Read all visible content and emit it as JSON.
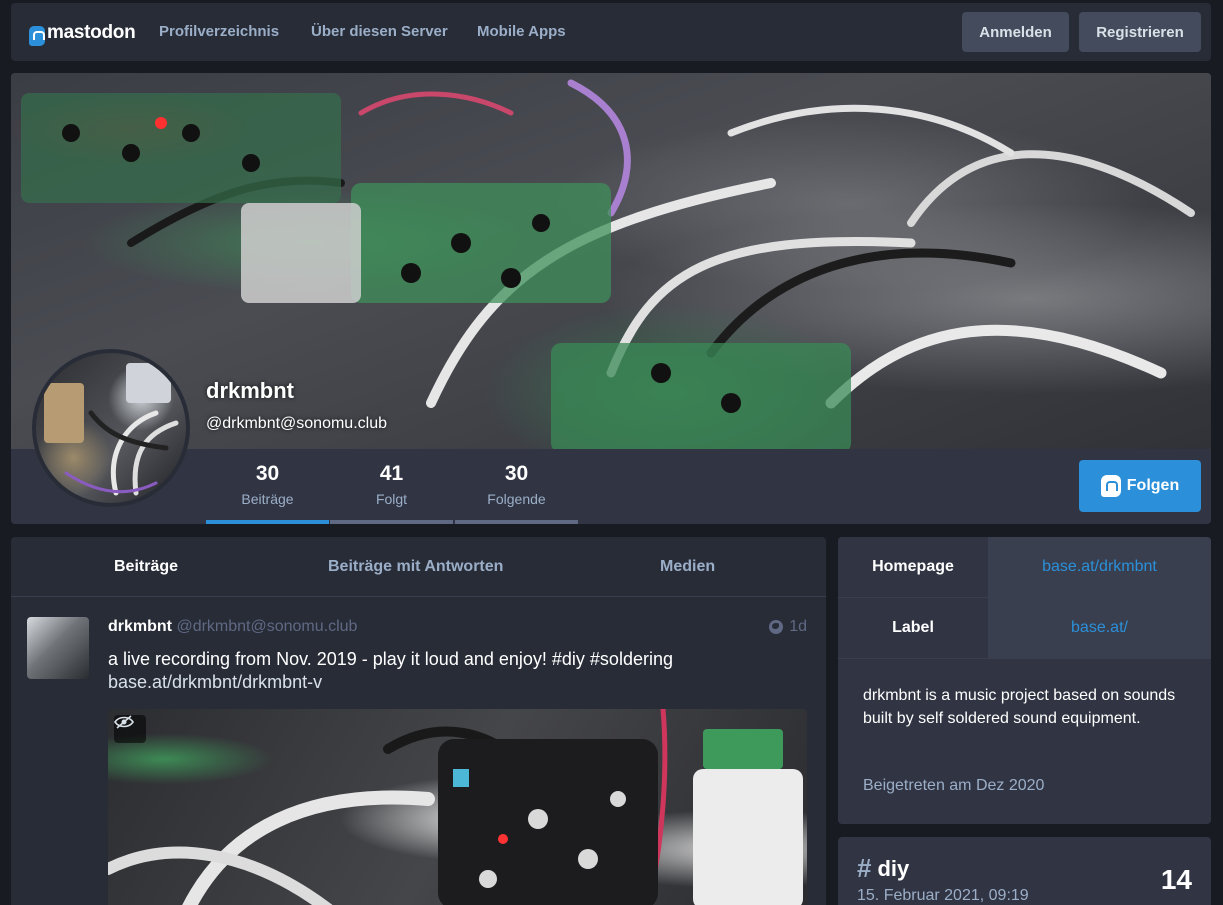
{
  "nav": {
    "logo_text": "mastodon",
    "links": [
      "Profilverzeichnis",
      "Über diesen Server",
      "Mobile Apps"
    ],
    "login_label": "Anmelden",
    "register_label": "Registrieren"
  },
  "profile": {
    "display_name": "drkmbnt",
    "acct": "@drkmbnt@sonomu.club",
    "counters": [
      {
        "value": "30",
        "label": "Beiträge"
      },
      {
        "value": "41",
        "label": "Folgt"
      },
      {
        "value": "30",
        "label": "Folgende"
      }
    ],
    "follow_label": "Folgen"
  },
  "tabs": [
    "Beiträge",
    "Beiträge mit Antworten",
    "Medien"
  ],
  "status": {
    "display_name": "drkmbnt",
    "acct": "@drkmbnt@sonomu.club",
    "time": "1d",
    "text": "a live recording from Nov. 2019 - play it loud and enjoy! #diy #soldering",
    "link": "base.at/drkmbnt/drkmbnt-v"
  },
  "fields": [
    {
      "name": "Homepage",
      "value": "base.at/drkmbnt"
    },
    {
      "name": "Label",
      "value": "base.at/"
    }
  ],
  "bio": "drkmbnt is a music project based on sounds built by self soldered sound equipment.",
  "joined": "Beigetreten am Dez 2020",
  "hashtag": {
    "name": "diy",
    "date": "15. Februar 2021, 09:19",
    "count": "14"
  },
  "colors": {
    "background": "#191b22",
    "panel": "#282c37",
    "accent": "#2b90d9",
    "muted_text": "#9baec8"
  }
}
